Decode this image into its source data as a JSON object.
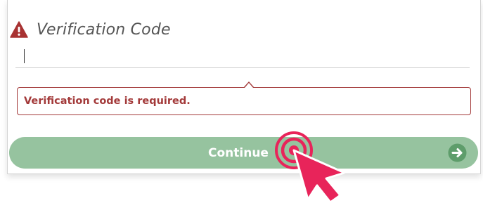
{
  "form": {
    "field_label": "Verification Code",
    "field_value": "",
    "field_icon": "warning-triangle-icon",
    "error_message": "Verification code is required.",
    "continue_label": "Continue",
    "continue_icon": "arrow-right-circle-icon"
  },
  "colors": {
    "error": "#a33a3a",
    "button_bg": "#96c39f",
    "button_arrow_bg": "#5e9d6b",
    "cursor": "#e8245a"
  }
}
